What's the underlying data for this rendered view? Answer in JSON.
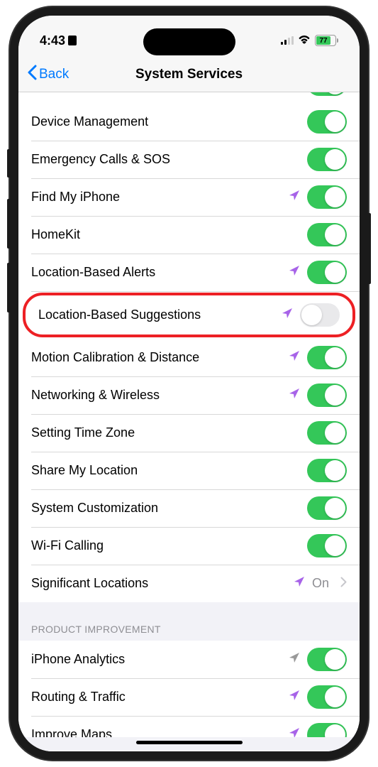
{
  "statusBar": {
    "time": "4:43",
    "battery": "77"
  },
  "nav": {
    "back": "Back",
    "title": "System Services"
  },
  "rows": {
    "deviceManagement": "Device Management",
    "emergencyCalls": "Emergency Calls & SOS",
    "findMyiPhone": "Find My iPhone",
    "homeKit": "HomeKit",
    "locationAlerts": "Location-Based Alerts",
    "locationSuggestions": "Location-Based Suggestions",
    "motionCalibration": "Motion Calibration & Distance",
    "networking": "Networking & Wireless",
    "timeZone": "Setting Time Zone",
    "shareLocation": "Share My Location",
    "systemCustomization": "System Customization",
    "wifiCalling": "Wi-Fi Calling",
    "significantLocations": "Significant Locations",
    "significantLocationsValue": "On",
    "iphoneAnalytics": "iPhone Analytics",
    "routingTraffic": "Routing & Traffic",
    "improveMaps": "Improve Maps"
  },
  "sectionHeaders": {
    "productImprovement": "PRODUCT IMPROVEMENT"
  }
}
